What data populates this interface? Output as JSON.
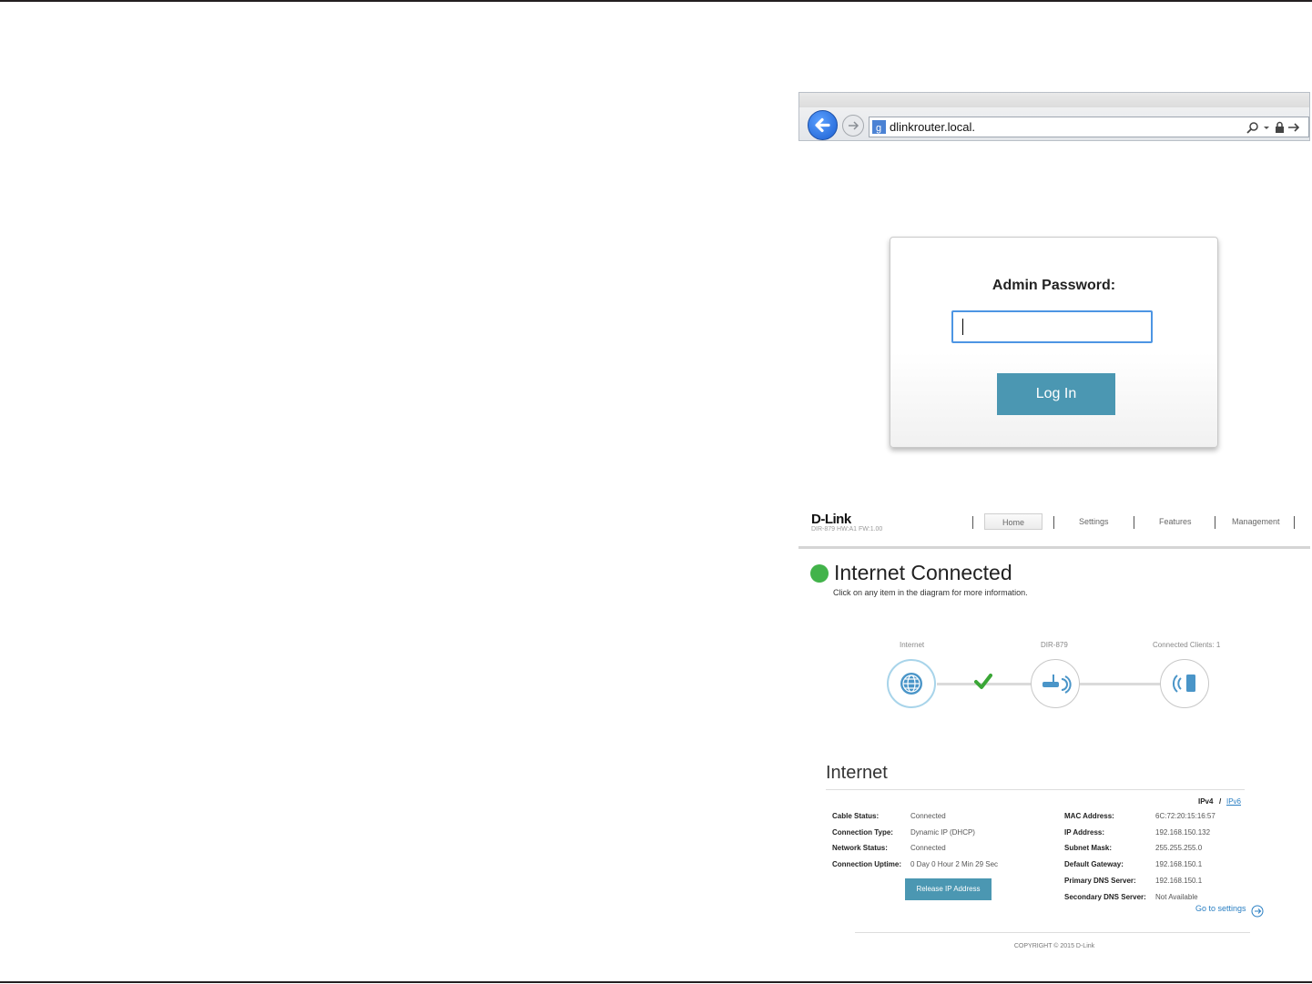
{
  "browser": {
    "url": "dlinkrouter.local."
  },
  "login": {
    "label": "Admin Password:",
    "password_value": "",
    "button_label": "Log In"
  },
  "dashboard": {
    "logo": "D-Link",
    "model": "DIR-879 HW:A1 FW:1.00",
    "nav": {
      "home": "Home",
      "settings": "Settings",
      "features": "Features",
      "management": "Management"
    },
    "status": {
      "title": "Internet Connected",
      "subtitle": "Click on any item in the diagram for more information.",
      "color": "#42b34a"
    },
    "diagram": {
      "internet_label": "Internet",
      "router_label": "DIR-879",
      "clients_label": "Connected Clients: 1"
    },
    "internet": {
      "title": "Internet",
      "ipv4": "IPv4",
      "separator": "/",
      "ipv6": "IPv6",
      "left": [
        {
          "label": "Cable Status:",
          "value": "Connected"
        },
        {
          "label": "Connection Type:",
          "value": "Dynamic IP (DHCP)"
        },
        {
          "label": "Network Status:",
          "value": "Connected"
        },
        {
          "label": "Connection Uptime:",
          "value": "0 Day 0 Hour 2 Min 29 Sec"
        }
      ],
      "right": [
        {
          "label": "MAC Address:",
          "value": "6C:72:20:15:16:57"
        },
        {
          "label": "IP Address:",
          "value": "192.168.150.132"
        },
        {
          "label": "Subnet Mask:",
          "value": "255.255.255.0"
        },
        {
          "label": "Default Gateway:",
          "value": "192.168.150.1"
        },
        {
          "label": "Primary DNS Server:",
          "value": "192.168.150.1"
        },
        {
          "label": "Secondary DNS Server:",
          "value": "Not Available"
        }
      ],
      "release_button": "Release IP Address",
      "go_to_settings": "Go to settings"
    },
    "copyright": "COPYRIGHT © 2015 D-Link"
  },
  "colors": {
    "accent": "#4b97b2",
    "link": "#2a7fc3",
    "focus_border": "#4d95e3"
  }
}
